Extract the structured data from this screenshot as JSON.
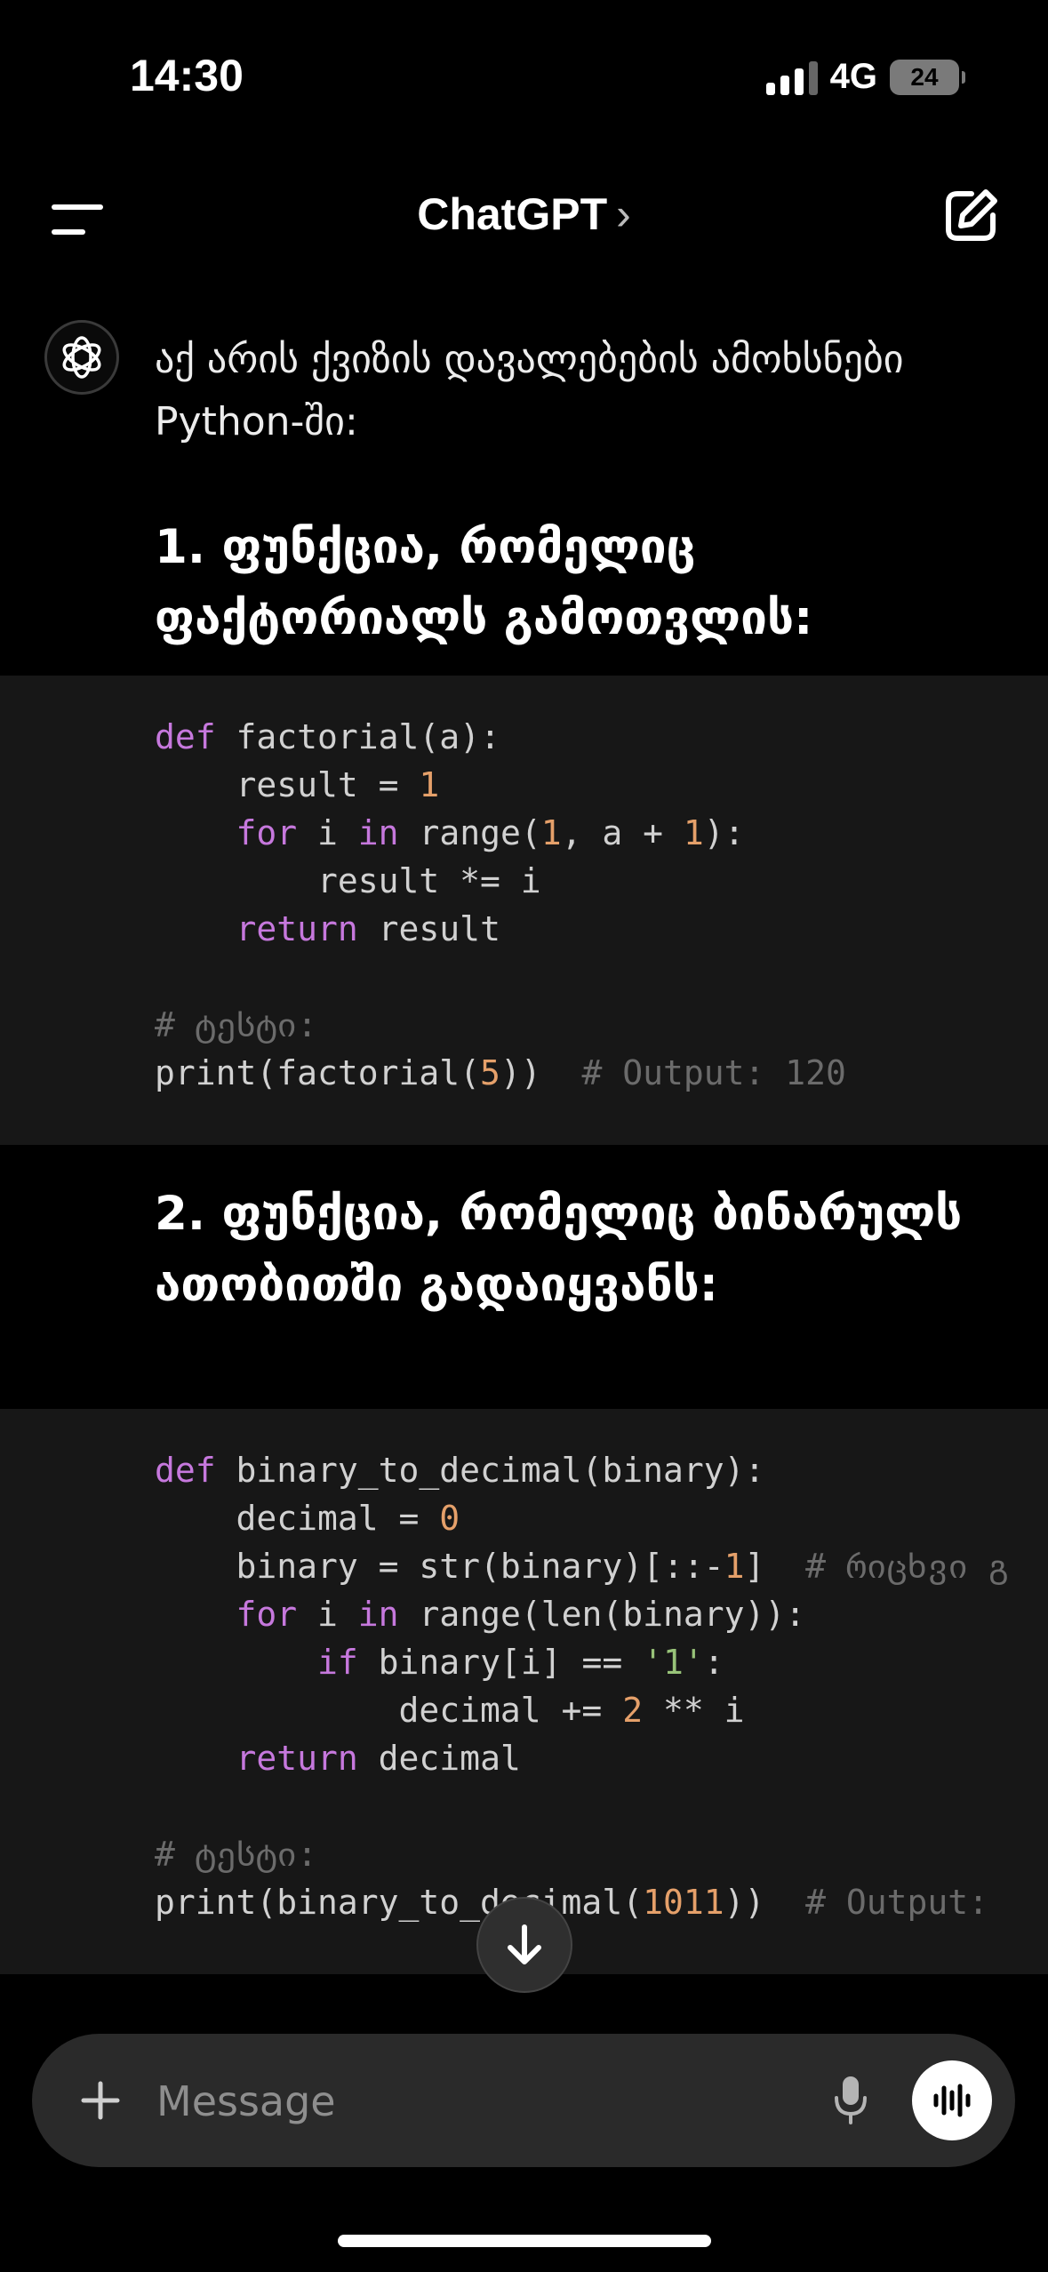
{
  "status_bar": {
    "time": "14:30",
    "network": "4G",
    "battery": "24"
  },
  "header": {
    "title": "ChatGPT",
    "chevron": "›"
  },
  "message": {
    "intro": "აქ არის ქვიზის დავალებების ამოხსნები Python-ში:",
    "heading_1": "1. ფუნქცია, რომელიც ფაქტორიალს გამოთვლის:",
    "heading_2": "2. ფუნქცია, რომელიც ბინარულს ათობითში გადაიყვანს:"
  },
  "code_1": [
    [
      [
        "kw",
        "def"
      ],
      [
        "t",
        " factorial(a):"
      ]
    ],
    [
      [
        "t",
        "    result = "
      ],
      [
        "num",
        "1"
      ]
    ],
    [
      [
        "t",
        "    "
      ],
      [
        "kw",
        "for"
      ],
      [
        "t",
        " i "
      ],
      [
        "kw",
        "in"
      ],
      [
        "t",
        " range("
      ],
      [
        "num",
        "1"
      ],
      [
        "t",
        ", a + "
      ],
      [
        "num",
        "1"
      ],
      [
        "t",
        "):"
      ]
    ],
    [
      [
        "t",
        "        result *= i"
      ]
    ],
    [
      [
        "t",
        "    "
      ],
      [
        "kw",
        "return"
      ],
      [
        "t",
        " result"
      ]
    ],
    [
      [
        "t",
        ""
      ]
    ],
    [
      [
        "cm",
        "# ტესტი:"
      ]
    ],
    [
      [
        "t",
        "print(factorial("
      ],
      [
        "num",
        "5"
      ],
      [
        "t",
        "))  "
      ],
      [
        "cm",
        "# Output: 120"
      ]
    ]
  ],
  "code_2": [
    [
      [
        "kw",
        "def"
      ],
      [
        "t",
        " binary_to_decimal(binary):"
      ]
    ],
    [
      [
        "t",
        "    decimal = "
      ],
      [
        "num",
        "0"
      ]
    ],
    [
      [
        "t",
        "    binary = str(binary)[::-"
      ],
      [
        "num",
        "1"
      ],
      [
        "t",
        "]  "
      ],
      [
        "cm",
        "# რიცხვი გ"
      ]
    ],
    [
      [
        "t",
        "    "
      ],
      [
        "kw",
        "for"
      ],
      [
        "t",
        " i "
      ],
      [
        "kw",
        "in"
      ],
      [
        "t",
        " range(len(binary)):"
      ]
    ],
    [
      [
        "t",
        "        "
      ],
      [
        "kw",
        "if"
      ],
      [
        "t",
        " binary[i] == "
      ],
      [
        "str",
        "'1'"
      ],
      [
        "t",
        ":"
      ]
    ],
    [
      [
        "t",
        "            decimal += "
      ],
      [
        "num",
        "2"
      ],
      [
        "t",
        " ** i"
      ]
    ],
    [
      [
        "t",
        "    "
      ],
      [
        "kw",
        "return"
      ],
      [
        "t",
        " decimal"
      ]
    ],
    [
      [
        "t",
        ""
      ]
    ],
    [
      [
        "cm",
        "# ტესტი:"
      ]
    ],
    [
      [
        "t",
        "print(binary_to_decimal("
      ],
      [
        "num",
        "1011"
      ],
      [
        "t",
        "))  "
      ],
      [
        "cm",
        "# Output:"
      ]
    ]
  ],
  "composer": {
    "placeholder": "Message"
  },
  "icons": {
    "menu": "menu-icon",
    "new_chat": "new-chat-icon",
    "avatar": "openai-logo-icon",
    "scroll": "arrow-down-icon",
    "plus": "plus-icon",
    "mic": "mic-icon",
    "voice": "voice-mode-icon"
  }
}
